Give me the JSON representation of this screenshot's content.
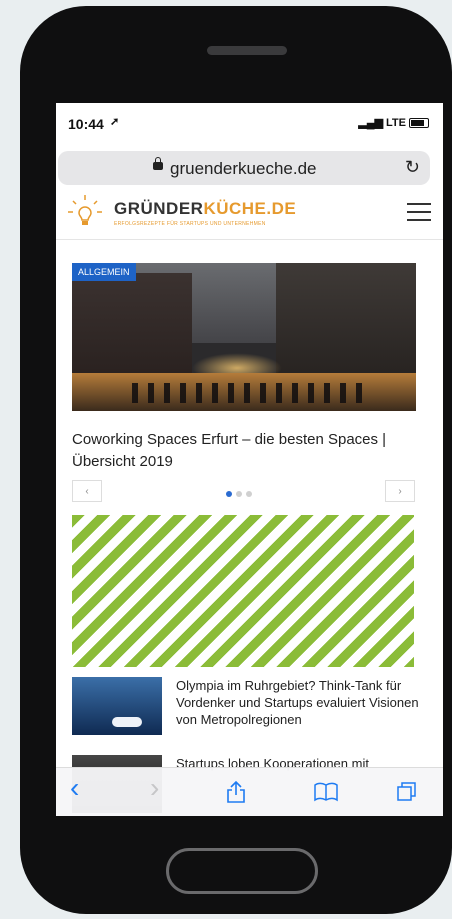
{
  "status": {
    "time": "10:44",
    "location_icon": "location-arrow-icon",
    "network": "LTE",
    "signal_icon": "signal-bars-icon",
    "battery_icon": "battery-icon"
  },
  "browser": {
    "url": "gruenderkueche.de",
    "lock_icon": "lock-icon",
    "reload_icon": "reload-icon"
  },
  "site": {
    "logo_main_a": "GRÜNDER",
    "logo_main_b": "KÜCHE.DE",
    "logo_sub": "ERFOLGSREZEPTE FÜR STARTUPS UND UNTERNEHMEN",
    "menu_icon": "hamburger-icon"
  },
  "slider": {
    "badge": "ALLGEMEIN",
    "title": "Coworking Spaces Erfurt – die besten Spaces | Übersicht 2019",
    "prev": "‹",
    "next": "›",
    "dots": 3,
    "active_dot": 0
  },
  "articles": [
    {
      "title": "Olympia im Ruhrgebiet? Think-Tank für Vordenker und Startups evaluiert Visionen von Metropolregionen"
    },
    {
      "title": "Startups loben Kooperationen mit"
    }
  ],
  "toolbar": {
    "back": "‹",
    "forward": "›",
    "share_icon": "share-icon",
    "bookmarks_icon": "bookmarks-icon",
    "tabs_icon": "tabs-icon"
  },
  "colors": {
    "accent_blue": "#1e63c6",
    "logo_orange": "#e69a2e",
    "ad_green": "#8bbc38",
    "ios_blue": "#1e7bf2"
  }
}
